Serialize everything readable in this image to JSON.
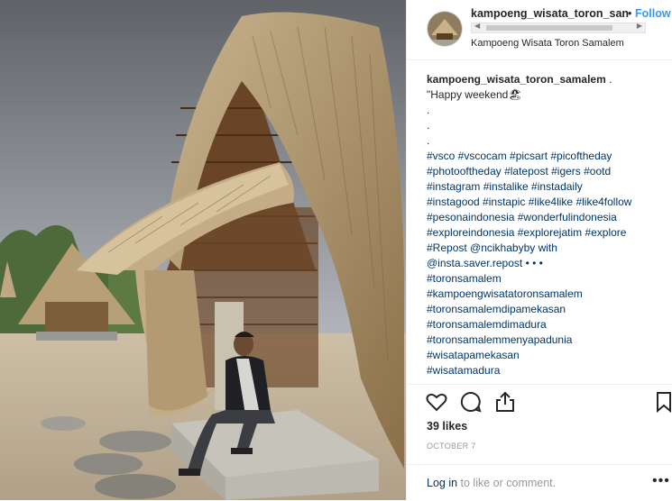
{
  "post": {
    "username": "kampoeng_wisata_toron_san",
    "separator": "•",
    "follow_label": "Follow",
    "location": "Kampoeng Wisata Toron Samalem",
    "photo_alt": "thatched hut",
    "caption": {
      "username": "kampoeng_wisata_toron_samalem",
      "username_suffix": " .",
      "lines": [
        "\"Happy weekend🏖",
        ".",
        ".",
        ".",
        "#vsco #vscocam #picsart #picoftheday",
        "#photooftheday #latepost #igers #ootd",
        "#instagram #instalike #instadaily",
        "#instagood #instapic #like4like #like4follow",
        "#pesonaindonesia #wonderfulindonesia",
        "#exploreindonesia #explorejatim #explore",
        "#Repost @ncikhabyby with",
        "@insta.saver.repost • • •",
        "#toronsamalem",
        "#kampoengwisatatoronsamalem",
        "#toronsamalemdipamekasan",
        "#toronsamalemdimadura",
        "#toronsamalemmenyapadunia",
        "#wisatapamekasan",
        "#wisatamadura"
      ]
    },
    "icons": [
      "heart-icon",
      "comment-icon",
      "share-icon",
      "bookmark-icon"
    ],
    "likes": "39 likes",
    "date": "OCTOBER 7",
    "login_link": "Log in",
    "login_text": " to like or comment.",
    "more": "•••"
  }
}
